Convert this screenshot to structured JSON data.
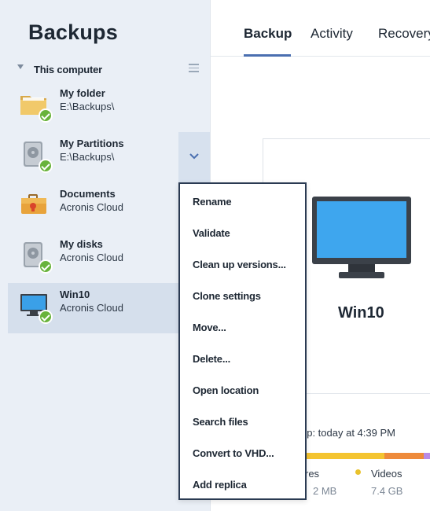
{
  "sidebar": {
    "title": "Backups",
    "section_label": "This computer",
    "items": [
      {
        "name": "My folder",
        "location": "E:\\Backups\\",
        "icon": "folder-icon"
      },
      {
        "name": "My Partitions",
        "location": "E:\\Backups\\",
        "icon": "hard-drive-icon"
      },
      {
        "name": "Documents",
        "location": "Acronis Cloud",
        "icon": "briefcase-icon"
      },
      {
        "name": "My disks",
        "location": "Acronis Cloud",
        "icon": "hard-drive-icon"
      },
      {
        "name": "Win10",
        "location": "Acronis Cloud",
        "icon": "monitor-icon"
      }
    ]
  },
  "tabs": [
    {
      "label": "Backup",
      "active": true
    },
    {
      "label": "Activity",
      "active": false
    },
    {
      "label": "Recovery",
      "active": false
    }
  ],
  "main": {
    "source_title": "Win10",
    "last_backup": "up: today at 4:39 PM",
    "legend": [
      {
        "label": "res",
        "size": "2 MB"
      },
      {
        "label": "Videos",
        "size": "7.4 GB"
      }
    ],
    "usage_colors": [
      "#f4c430",
      "#ee8a3a",
      "#b98be6"
    ]
  },
  "context_menu": {
    "items": [
      "Rename",
      "Validate",
      "Clean up versions...",
      "Clone settings",
      "Move...",
      "Delete...",
      "Open location",
      "Search files",
      "Convert to VHD...",
      "Add replica"
    ]
  },
  "colors": {
    "sidebar_bg": "#eaeff6",
    "accent": "#4a6fb0",
    "check_green": "#68b33b",
    "menu_border": "#2a3a52"
  }
}
